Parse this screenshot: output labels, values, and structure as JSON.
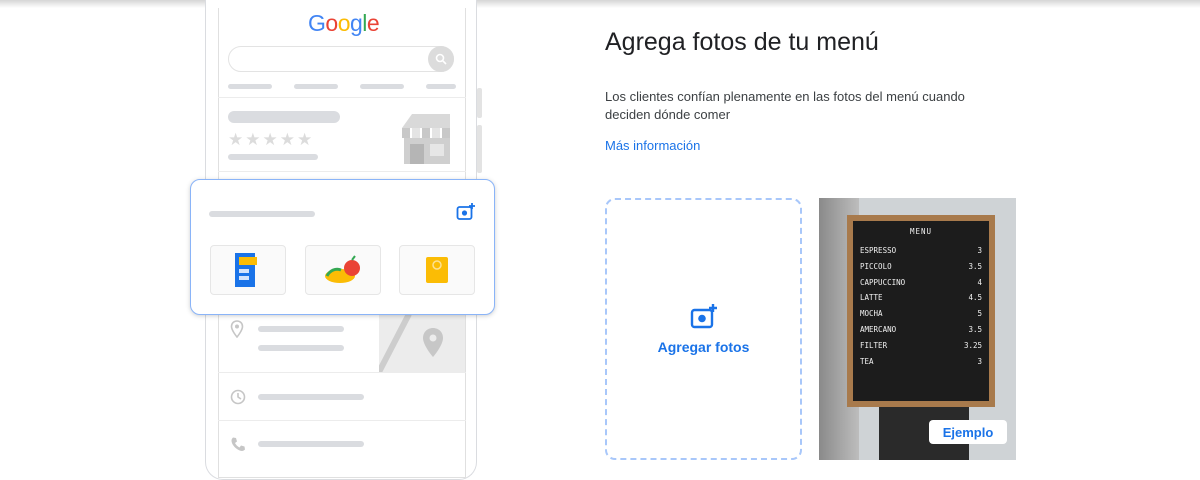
{
  "preview": {
    "google_logo": [
      {
        "ch": "G",
        "color": "#4285F4"
      },
      {
        "ch": "o",
        "color": "#EA4335"
      },
      {
        "ch": "o",
        "color": "#FBBC05"
      },
      {
        "ch": "g",
        "color": "#4285F4"
      },
      {
        "ch": "l",
        "color": "#34A853"
      },
      {
        "ch": "e",
        "color": "#EA4335"
      }
    ],
    "stars": "★★★★★",
    "icons": [
      "search-icon",
      "storefront-icon",
      "add-photo-icon",
      "menu-photo-icon",
      "food-photo-icon",
      "drink-photo-icon",
      "location-pin-icon",
      "map-pin-icon",
      "clock-icon",
      "phone-icon"
    ]
  },
  "main": {
    "heading": "Agrega fotos de tu menú",
    "description": "Los clientes confían plenamente en las fotos del menú cuando deciden dónde comer",
    "more_link": "Más información",
    "upload_label": "Agregar fotos",
    "example_label": "Ejemplo"
  },
  "menu_board": {
    "title": "MENU",
    "items": [
      {
        "name": "ESPRESSO",
        "price": "3"
      },
      {
        "name": "PICCOLO",
        "price": "3.5"
      },
      {
        "name": "CAPPUCCINO",
        "price": "4"
      },
      {
        "name": "LATTE",
        "price": "4.5"
      },
      {
        "name": "MOCHA",
        "price": "5"
      },
      {
        "name": "AMERCANO",
        "price": "3.5"
      },
      {
        "name": "FILTER",
        "price": "3.25"
      },
      {
        "name": "TEA",
        "price": "3"
      }
    ]
  },
  "colors": {
    "accent": "#1a73e8",
    "dashed_border": "#a8c7fa",
    "placeholder_gray": "#dadce0"
  }
}
